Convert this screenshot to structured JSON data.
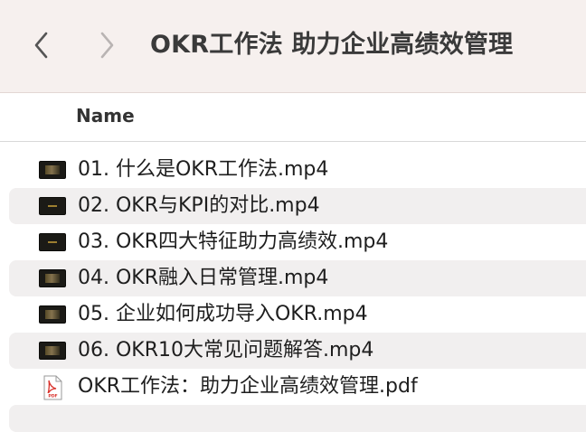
{
  "window": {
    "title": "OKR工作法 助力企业高绩效管理"
  },
  "toolbar": {
    "back_icon": "chevron-left-icon",
    "forward_icon": "chevron-right-icon"
  },
  "columns": {
    "name": "Name"
  },
  "files": [
    {
      "name": "01. 什么是OKR工作法.mp4",
      "icon": "video-thumbnail-icon"
    },
    {
      "name": "02. OKR与KPI的对比.mp4",
      "icon": "video-thumbnail-icon"
    },
    {
      "name": "03. OKR四大特征助力高绩效.mp4",
      "icon": "video-thumbnail-icon"
    },
    {
      "name": "04. OKR融入日常管理.mp4",
      "icon": "video-thumbnail-icon"
    },
    {
      "name": "05. 企业如何成功导入OKR.mp4",
      "icon": "video-thumbnail-icon"
    },
    {
      "name": "06. OKR10大常见问题解答.mp4",
      "icon": "video-thumbnail-icon"
    },
    {
      "name": "OKR工作法：助力企业高绩效管理.pdf",
      "icon": "pdf-file-icon"
    }
  ],
  "colors": {
    "toolbar_bg": "#f6f0ee",
    "row_alt_bg": "#f1efef",
    "pdf_red": "#d9312b"
  }
}
